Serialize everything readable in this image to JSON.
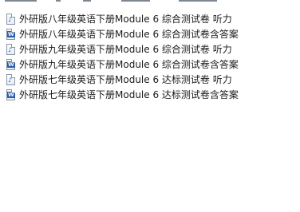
{
  "files": [
    {
      "name": "外研版八年级英语下册Module 6 综合测试卷 听力",
      "type": "audio",
      "icon": "audio-file-icon"
    },
    {
      "name": "外研版八年级英语下册Module 6 综合测试卷含答案",
      "type": "word",
      "icon": "word-doc-icon"
    },
    {
      "name": "外研版九年级英语下册Module 6 综合测试卷 听力",
      "type": "audio",
      "icon": "audio-file-icon"
    },
    {
      "name": "外研版九年级英语下册Module 6 综合测试卷含答案",
      "type": "word",
      "icon": "word-doc-icon"
    },
    {
      "name": "外研版七年级英语下册Module 6 达标测试卷 听力",
      "type": "audio",
      "icon": "audio-file-icon"
    },
    {
      "name": "外研版七年级英语下册Module 6 达标测试卷含答案",
      "type": "word",
      "icon": "word-doc-icon"
    }
  ]
}
